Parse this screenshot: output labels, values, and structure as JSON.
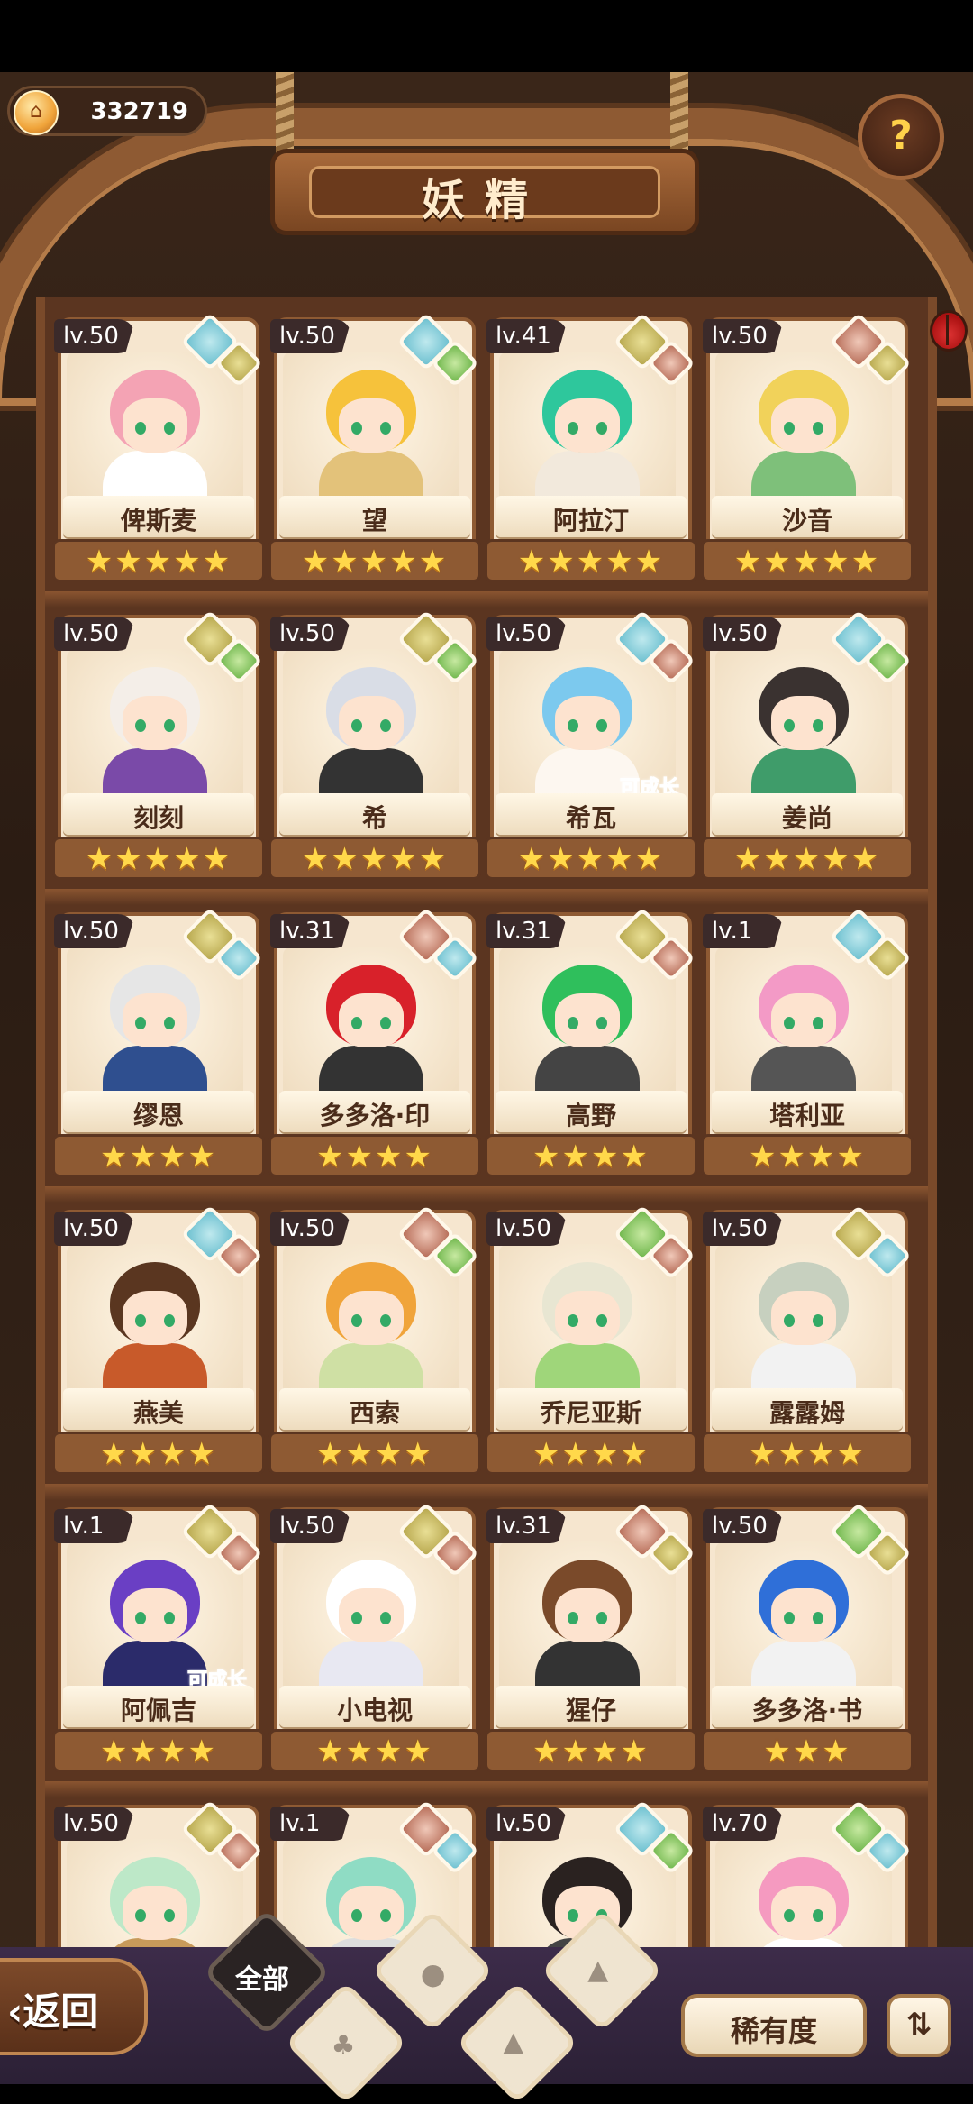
{
  "header": {
    "currency_value": "332719",
    "title": "妖精",
    "help_symbol": "?"
  },
  "cards": [
    {
      "level": "lv.50",
      "name": "俾斯麦",
      "stars": 5,
      "element": "water",
      "sub": "earth",
      "hair": "#f4a3b4",
      "outfit": "#fff",
      "growable": false
    },
    {
      "level": "lv.50",
      "name": "望",
      "stars": 5,
      "element": "water",
      "sub": "plant",
      "hair": "#f6c23b",
      "outfit": "#e3c27a",
      "growable": false
    },
    {
      "level": "lv.41",
      "name": "阿拉汀",
      "stars": 5,
      "element": "earth",
      "sub": "fire",
      "hair": "#2ec79c",
      "outfit": "#f2e9dc",
      "growable": false
    },
    {
      "level": "lv.50",
      "name": "沙音",
      "stars": 5,
      "element": "fire",
      "sub": "earth",
      "hair": "#f1d25a",
      "outfit": "#7ec07a",
      "growable": false
    },
    {
      "level": "lv.50",
      "name": "刻刻",
      "stars": 5,
      "element": "earth",
      "sub": "plant",
      "hair": "#f4eee8",
      "outfit": "#7a4aa8",
      "growable": false
    },
    {
      "level": "lv.50",
      "name": "希",
      "stars": 5,
      "element": "earth",
      "sub": "plant",
      "hair": "#d9dde6",
      "outfit": "#333",
      "growable": false
    },
    {
      "level": "lv.50",
      "name": "希瓦",
      "stars": 5,
      "element": "water",
      "sub": "fire",
      "hair": "#7cc9ee",
      "outfit": "#fdf7f0",
      "growable": true
    },
    {
      "level": "lv.50",
      "name": "姜尚",
      "stars": 5,
      "element": "water",
      "sub": "plant",
      "hair": "#3a3230",
      "outfit": "#3f9c6a",
      "growable": false
    },
    {
      "level": "lv.50",
      "name": "缪恩",
      "stars": 4,
      "element": "earth",
      "sub": "water",
      "hair": "#e6e6e6",
      "outfit": "#2f4f8f",
      "growable": false
    },
    {
      "level": "lv.31",
      "name": "多多洛·印",
      "stars": 4,
      "element": "fire",
      "sub": "water",
      "hair": "#d8212a",
      "outfit": "#333",
      "growable": false
    },
    {
      "level": "lv.31",
      "name": "高野",
      "stars": 4,
      "element": "earth",
      "sub": "fire",
      "hair": "#2fbf5c",
      "outfit": "#444",
      "growable": false
    },
    {
      "level": "lv.1",
      "name": "塔利亚",
      "stars": 4,
      "element": "water",
      "sub": "earth",
      "hair": "#f39ac6",
      "outfit": "#555",
      "growable": false
    },
    {
      "level": "lv.50",
      "name": "燕美",
      "stars": 4,
      "element": "water",
      "sub": "fire",
      "hair": "#5a3620",
      "outfit": "#c85a2a",
      "growable": false
    },
    {
      "level": "lv.50",
      "name": "西索",
      "stars": 4,
      "element": "fire",
      "sub": "plant",
      "hair": "#f0a43a",
      "outfit": "#cfe0a4",
      "growable": false
    },
    {
      "level": "lv.50",
      "name": "乔尼亚斯",
      "stars": 4,
      "element": "plant",
      "sub": "fire",
      "hair": "#e8e6d2",
      "outfit": "#9fd67a",
      "growable": false
    },
    {
      "level": "lv.50",
      "name": "露露姆",
      "stars": 4,
      "element": "earth",
      "sub": "water",
      "hair": "#c7d0bf",
      "outfit": "#f2f2f2",
      "growable": false
    },
    {
      "level": "lv.1",
      "name": "阿佩吉",
      "stars": 4,
      "element": "earth",
      "sub": "fire",
      "hair": "#6a3fc4",
      "outfit": "#2b2b6a",
      "growable": true
    },
    {
      "level": "lv.50",
      "name": "小电视",
      "stars": 4,
      "element": "earth",
      "sub": "fire",
      "hair": "#ffffff",
      "outfit": "#e8e8f2",
      "growable": false
    },
    {
      "level": "lv.31",
      "name": "猩仔",
      "stars": 4,
      "element": "fire",
      "sub": "earth",
      "hair": "#7a4a2a",
      "outfit": "#333",
      "growable": false
    },
    {
      "level": "lv.50",
      "name": "多多洛·书",
      "stars": 3,
      "element": "plant",
      "sub": "earth",
      "hair": "#2f6fd8",
      "outfit": "#f2f2f2",
      "growable": false
    },
    {
      "level": "lv.50",
      "name": "",
      "stars": 0,
      "element": "earth",
      "sub": "fire",
      "hair": "#bde8c8",
      "outfit": "#c89a5a",
      "growable": false
    },
    {
      "level": "lv.1",
      "name": "",
      "stars": 0,
      "element": "fire",
      "sub": "water",
      "hair": "#8fdcc4",
      "outfit": "#ddd",
      "growable": false
    },
    {
      "level": "lv.50",
      "name": "",
      "stars": 0,
      "element": "water",
      "sub": "plant",
      "hair": "#2a2220",
      "outfit": "#444",
      "growable": false
    },
    {
      "level": "lv.70",
      "name": "",
      "stars": 0,
      "element": "plant",
      "sub": "water",
      "hair": "#f59ac0",
      "outfit": "#fff",
      "growable": false
    }
  ],
  "growable_label": "可成长",
  "footer": {
    "back_label": "‹返回",
    "filter_all_label": "全部",
    "filters": [
      "plant",
      "water",
      "earth",
      "fire"
    ],
    "sort_label": "稀有度",
    "order_symbol": "⇅"
  },
  "colors": {
    "water": "#6bbfcf",
    "earth": "#b6a64c",
    "fire": "#b56a55",
    "plant": "#6db54a",
    "star": "#ffd84a"
  }
}
